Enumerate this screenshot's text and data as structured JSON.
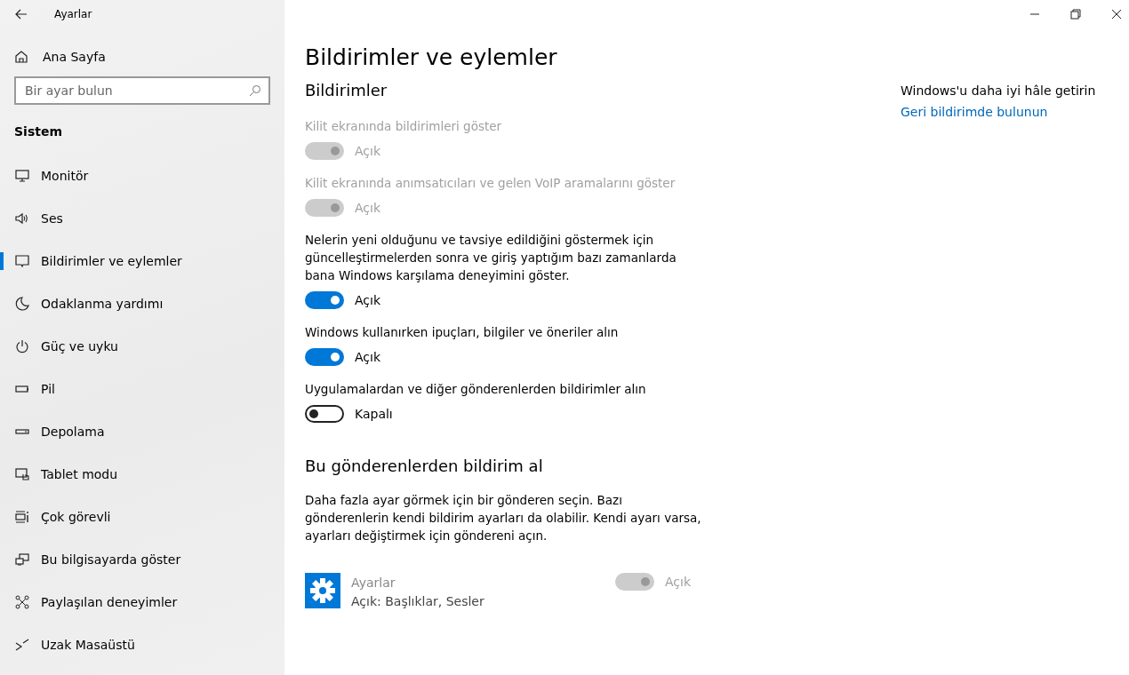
{
  "window": {
    "title": "Ayarlar"
  },
  "sidebar": {
    "home": "Ana Sayfa",
    "search": {
      "placeholder": "Bir ayar bulun"
    },
    "section": "Sistem",
    "items": [
      {
        "label": "Monitör",
        "selected": false
      },
      {
        "label": "Ses",
        "selected": false
      },
      {
        "label": "Bildirimler ve eylemler",
        "selected": true
      },
      {
        "label": "Odaklanma yardımı",
        "selected": false
      },
      {
        "label": "Güç ve uyku",
        "selected": false
      },
      {
        "label": "Pil",
        "selected": false
      },
      {
        "label": "Depolama",
        "selected": false
      },
      {
        "label": "Tablet modu",
        "selected": false
      },
      {
        "label": "Çok görevli",
        "selected": false
      },
      {
        "label": "Bu bilgisayarda göster",
        "selected": false
      },
      {
        "label": "Paylaşılan deneyimler",
        "selected": false
      },
      {
        "label": "Uzak Masaüstü",
        "selected": false
      }
    ]
  },
  "page": {
    "title": "Bildirimler ve eylemler",
    "section": "Bildirimler",
    "settings": [
      {
        "label": "Kilit ekranında bildirimleri göster",
        "on": true,
        "disabled": true,
        "state": "Açık"
      },
      {
        "label": "Kilit ekranında anımsatıcıları ve gelen VoIP aramalarını göster",
        "on": true,
        "disabled": true,
        "state": "Açık"
      },
      {
        "label": "Nelerin yeni olduğunu ve tavsiye edildiğini göstermek için güncelleştirmelerden sonra ve giriş yaptığım bazı zamanlarda bana Windows karşılama deneyimini göster.",
        "on": true,
        "disabled": false,
        "state": "Açık"
      },
      {
        "label": "Windows kullanırken ipuçları, bilgiler ve öneriler alın",
        "on": true,
        "disabled": false,
        "state": "Açık"
      },
      {
        "label": "Uygulamalardan ve diğer gönderenlerden bildirimler alın",
        "on": false,
        "disabled": false,
        "state": "Kapalı"
      }
    ],
    "senders_title": "Bu gönderenlerden bildirim al",
    "senders_desc": "Daha fazla ayar görmek için bir gönderen seçin. Bazı gönderenlerin kendi bildirim ayarları da olabilir. Kendi ayarı varsa, ayarları değiştirmek için göndereni açın.",
    "senders": [
      {
        "name": "Ayarlar",
        "detail": "Açık: Başlıklar, Sesler",
        "on": true,
        "disabled": true,
        "state": "Açık"
      }
    ]
  },
  "aside": {
    "title": "Windows'u daha iyi hâle getirin",
    "link": "Geri bildirimde bulunun"
  }
}
